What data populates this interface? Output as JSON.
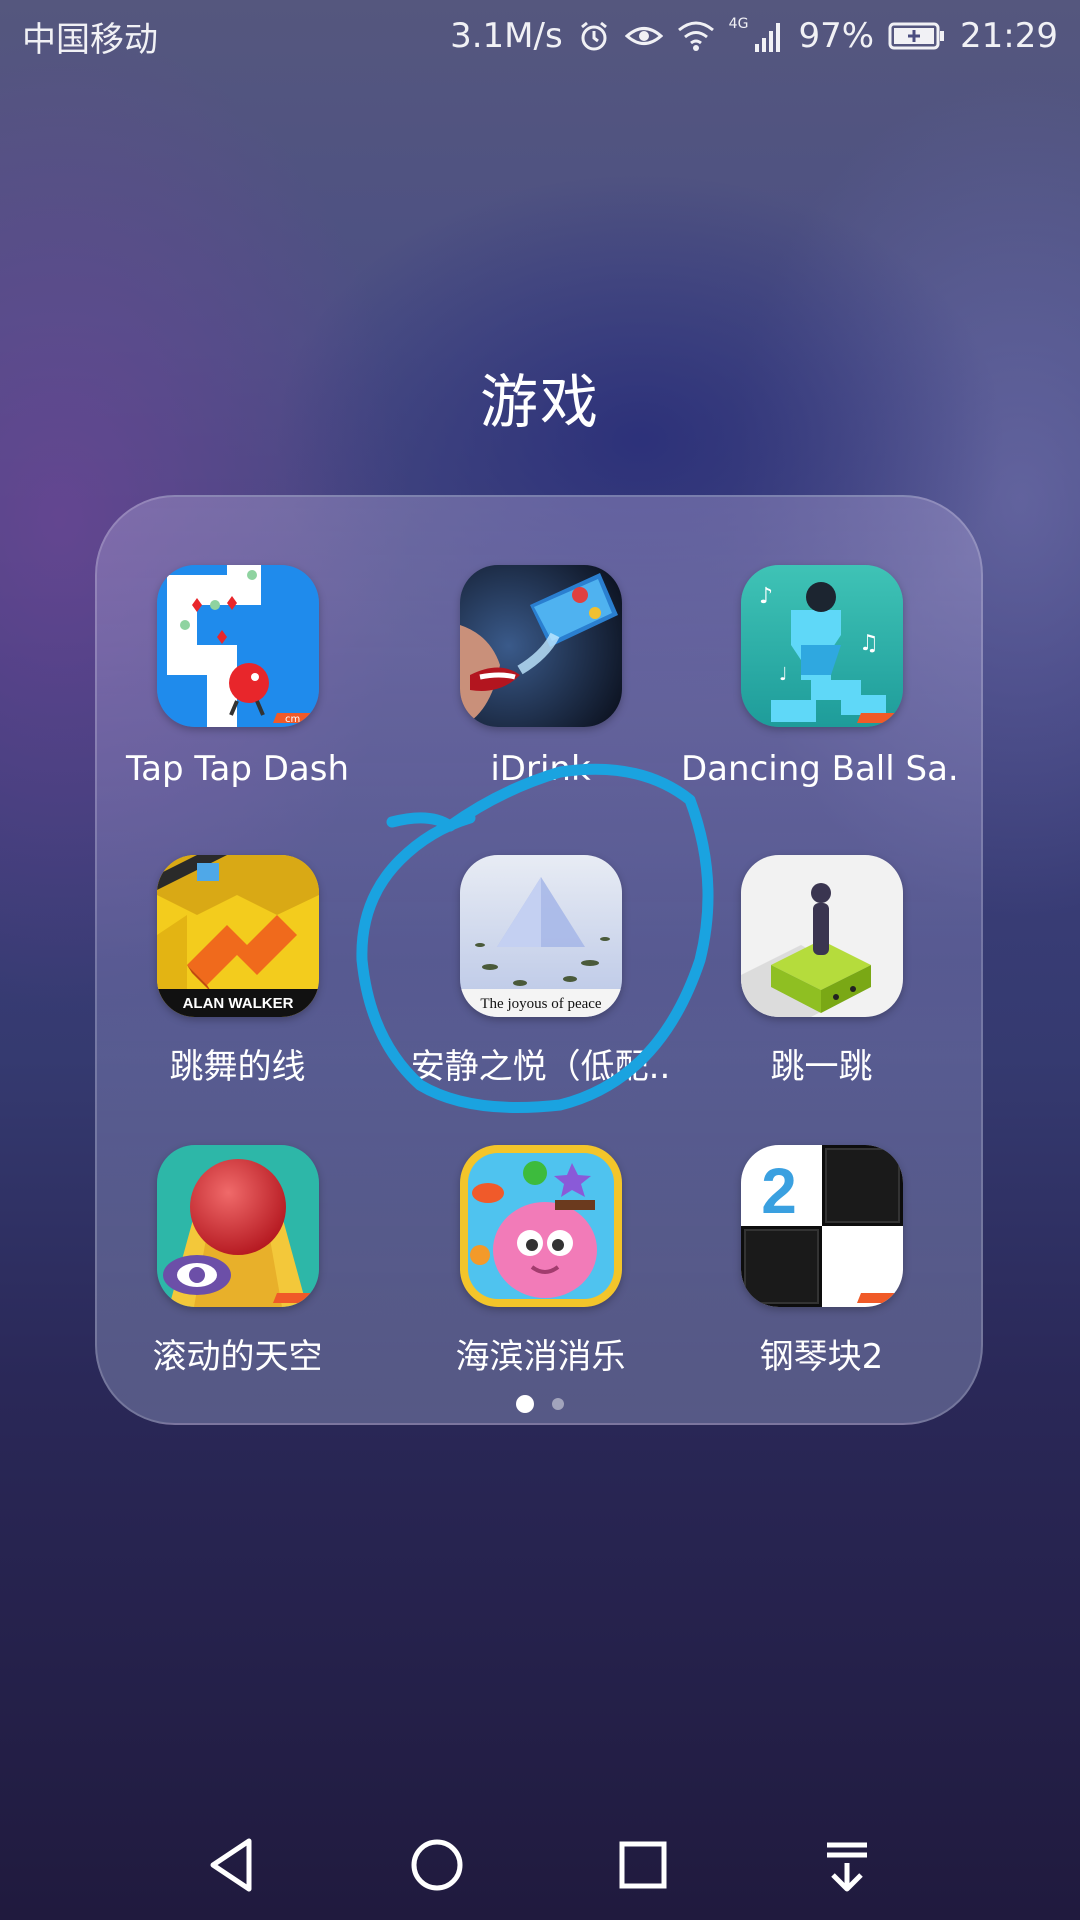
{
  "status_bar": {
    "carrier": "中国移动",
    "speed": "3.1M/s",
    "network": "4G",
    "battery": "97%",
    "time": "21:29"
  },
  "folder": {
    "title": "游戏",
    "apps": [
      {
        "label": "Tap Tap Dash",
        "icon": "tap-tap-dash-icon"
      },
      {
        "label": "iDrink",
        "icon": "idrink-icon"
      },
      {
        "label": "Dancing Ball Sa..",
        "icon": "dancing-ball-icon"
      },
      {
        "label": "跳舞的线",
        "icon": "dancing-line-icon",
        "icon_text": "ALAN WALKER"
      },
      {
        "label": "安静之悦（低配..",
        "icon": "joyous-peace-icon",
        "icon_text": "The joyous of peace"
      },
      {
        "label": "跳一跳",
        "icon": "jump-jump-icon"
      },
      {
        "label": "滚动的天空",
        "icon": "rolling-sky-icon"
      },
      {
        "label": "海滨消消乐",
        "icon": "seaside-match-icon"
      },
      {
        "label": "钢琴块2",
        "icon": "piano-tiles-2-icon",
        "icon_text": "2"
      }
    ],
    "pages": 2,
    "current_page": 1
  },
  "annotation": {
    "color": "#1aa3e0",
    "target": "安静之悦（低配.."
  },
  "nav": [
    "back",
    "home",
    "recents",
    "notifications"
  ],
  "colors": {
    "annotation": "#1aa3e0"
  }
}
